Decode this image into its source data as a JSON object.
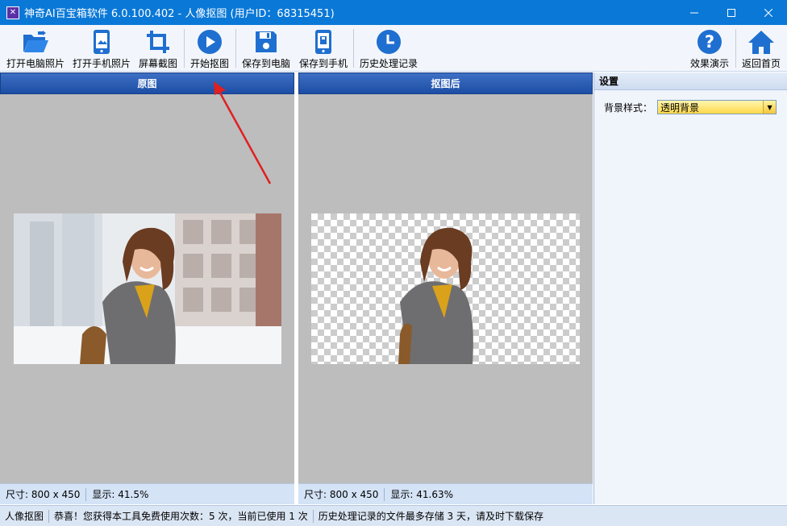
{
  "window": {
    "title": "神奇AI百宝箱软件 6.0.100.402 - 人像抠图 (用户ID：68315451)",
    "icon": "app-logo-icon"
  },
  "toolbar": {
    "items": [
      {
        "label": "打开电脑照片",
        "icon": "folder-open-icon"
      },
      {
        "label": "打开手机照片",
        "icon": "phone-icon"
      },
      {
        "label": "屏幕截图",
        "icon": "crop-icon"
      },
      {
        "label": "开始抠图",
        "icon": "play-icon"
      },
      {
        "label": "保存到电脑",
        "icon": "save-disk-icon"
      },
      {
        "label": "保存到手机",
        "icon": "phone-save-icon"
      },
      {
        "label": "历史处理记录",
        "icon": "clock-icon"
      }
    ],
    "right_items": [
      {
        "label": "效果演示",
        "icon": "help-icon"
      },
      {
        "label": "返回首页",
        "icon": "home-icon"
      }
    ]
  },
  "left_panel": {
    "title": "原图",
    "size_text": "尺寸: 800 x 450",
    "zoom_text": "显示: 41.5%"
  },
  "right_panel": {
    "title": "抠图后",
    "size_text": "尺寸: 800 x 450",
    "zoom_text": "显示: 41.63%"
  },
  "settings": {
    "title": "设置",
    "background_label": "背景样式：",
    "background_value": "透明背景"
  },
  "status": {
    "mode": "人像抠图",
    "message": "恭喜！您获得本工具免费使用次数：5 次，当前已使用 1 次",
    "note": "历史处理记录的文件最多存储 3 天，请及时下载保存"
  },
  "colors": {
    "titlebar": "#0a78d7",
    "accent": "#1d6fd8",
    "panel_header": "#1d4ea5",
    "annotation_arrow": "#e02020"
  }
}
